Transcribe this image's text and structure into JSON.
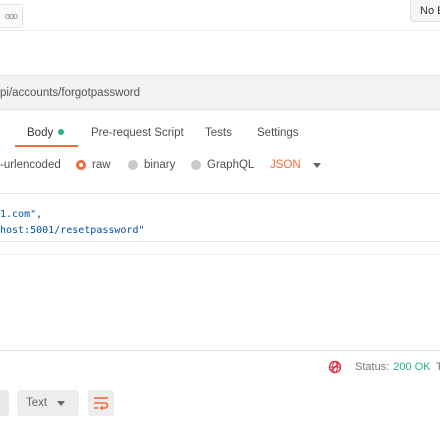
{
  "topbar": {
    "tab_overflow_glyph": "ooo",
    "env_label": "No E"
  },
  "url": {
    "text": "pi/accounts/forgotpassword"
  },
  "request_tabs": [
    {
      "label": "Body",
      "active": true
    },
    {
      "label": "Pre-request Script",
      "active": false
    },
    {
      "label": "Tests",
      "active": false
    },
    {
      "label": "Settings",
      "active": false
    }
  ],
  "body_types": [
    {
      "label": "-urlencoded",
      "selected": false
    },
    {
      "label": "raw",
      "selected": true
    },
    {
      "label": "binary",
      "selected": false
    },
    {
      "label": "GraphQL",
      "selected": false
    }
  ],
  "raw_format": "JSON",
  "editor": {
    "line1_string": "1.com\"",
    "line1_punc": ",",
    "line2_string": "host:5001/resetpassword\""
  },
  "response": {
    "status_label": "Status:",
    "status_value": "200 OK",
    "next_cut": "T",
    "format_label": "Text"
  },
  "colors": {
    "accent": "#f26b3a",
    "success": "#26b47f",
    "json_string": "#0451a5"
  }
}
